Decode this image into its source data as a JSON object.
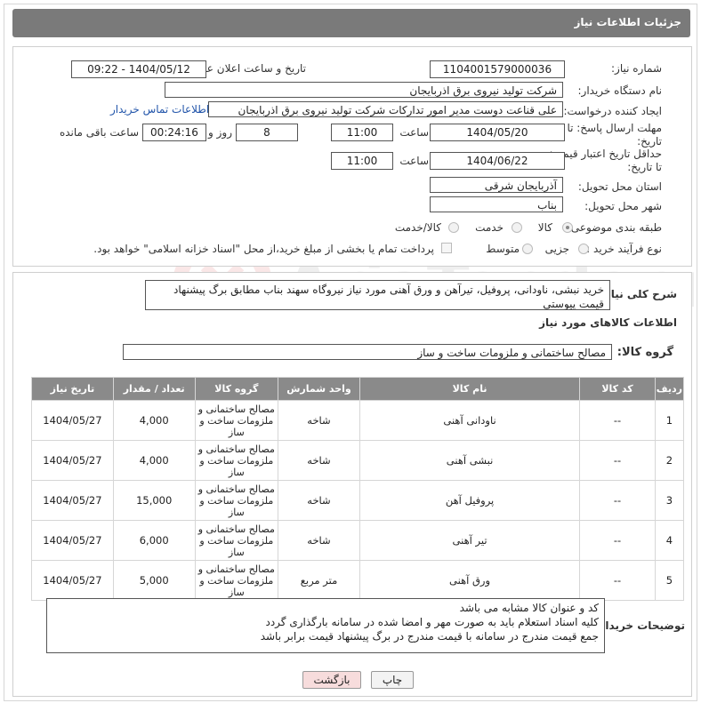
{
  "header": {
    "title": "جزئیات اطلاعات نیاز"
  },
  "form": {
    "need_number_label": "شماره نیاز:",
    "need_number": "1104001579000036",
    "announce_label": "تاریخ و ساعت اعلان عمومی:",
    "announce_value": "1404/05/12 - 09:22",
    "buyer_org_label": "نام دستگاه خریدار:",
    "buyer_org": "شرکت تولید نیروی برق اذربایجان",
    "requester_label": "ایجاد کننده درخواست:",
    "requester": "علی قناعت دوست مدیر امور تدارکات شرکت تولید نیروی برق اذربایجان",
    "contact_link": "اطلاعات تماس خریدار",
    "reply_deadline_label": "مهلت ارسال پاسخ: تا تاریخ:",
    "reply_date": "1404/05/20",
    "time_label": "ساعت",
    "reply_time": "11:00",
    "days_value": "8",
    "days_label": "روز و",
    "remaining_time": "00:24:16",
    "remaining_label": "ساعت باقی مانده",
    "price_validity_label": "حداقل تاریخ اعتبار قیمت: تا تاریخ:",
    "price_date": "1404/06/22",
    "price_time_label": "ساعت",
    "price_time": "11:00",
    "province_label": "استان محل تحویل:",
    "province": "آذربایجان شرقی",
    "city_label": "شهر محل تحویل:",
    "city": "بناب",
    "category_label": "طبقه بندی موضوعی:",
    "category_options": {
      "goods": "کالا",
      "service": "خدمت",
      "goods_service": "کالا/خدمت"
    },
    "process_label": "نوع فرآیند خرید :",
    "process_options": {
      "minor": "جزیی",
      "medium": "متوسط"
    },
    "payment_note": "پرداخت تمام یا بخشی از مبلغ خرید،از محل \"اسناد خزانه اسلامی\" خواهد بود."
  },
  "description": {
    "label": "شرح کلی نیاز:",
    "text": "خرید نبشی، ناودانی، پروفیل، تیرآهن و ورق آهنی مورد نیاز نیروگاه سهند بناب مطابق برگ پیشنهاد قیمت پیوستی"
  },
  "goods_info_title": "اطلاعات کالاهای مورد نیاز",
  "goods_group": {
    "label": "گروه کالا:",
    "value": "مصالح ساختمانی و ملزومات ساخت و ساز"
  },
  "table": {
    "headers": [
      "ردیف",
      "کد کالا",
      "نام کالا",
      "واحد شمارش",
      "گروه کالا",
      "تعداد / مقدار",
      "تاریخ نیاز"
    ],
    "rows": [
      {
        "row": "1",
        "code": "--",
        "name": "ناودانی آهنی",
        "unit": "شاخه",
        "group": "مصالح ساختمانی و ملزومات ساخت و ساز",
        "qty": "4,000",
        "date": "1404/05/27"
      },
      {
        "row": "2",
        "code": "--",
        "name": "نبشی آهنی",
        "unit": "شاخه",
        "group": "مصالح ساختمانی و ملزومات ساخت و ساز",
        "qty": "4,000",
        "date": "1404/05/27"
      },
      {
        "row": "3",
        "code": "--",
        "name": "پروفیل آهن",
        "unit": "شاخه",
        "group": "مصالح ساختمانی و ملزومات ساخت و ساز",
        "qty": "15,000",
        "date": "1404/05/27"
      },
      {
        "row": "4",
        "code": "--",
        "name": "تیر آهنی",
        "unit": "شاخه",
        "group": "مصالح ساختمانی و ملزومات ساخت و ساز",
        "qty": "6,000",
        "date": "1404/05/27"
      },
      {
        "row": "5",
        "code": "--",
        "name": "ورق آهنی",
        "unit": "متر مربع",
        "group": "مصالح ساختمانی و ملزومات ساخت و ساز",
        "qty": "5,000",
        "date": "1404/05/27"
      }
    ]
  },
  "buyer_notes": {
    "label": "توضیحات خریدار:",
    "lines": [
      "کد و عنوان کالا مشابه می باشد",
      "کلیه اسناد استعلام باید به صورت مهر و امضا شده در سامانه بارگذاری گردد",
      "جمع قیمت مندرج در سامانه با قیمت مندرج در برگ پیشنهاد قیمت برابر باشد"
    ]
  },
  "buttons": {
    "print": "چاپ",
    "back": "بازگشت"
  },
  "colors": {
    "header_bg": "#7a7a7a",
    "table_header_bg": "#8a8a8a",
    "link": "#2255aa",
    "back_button_bg": "#f7dcdc"
  }
}
